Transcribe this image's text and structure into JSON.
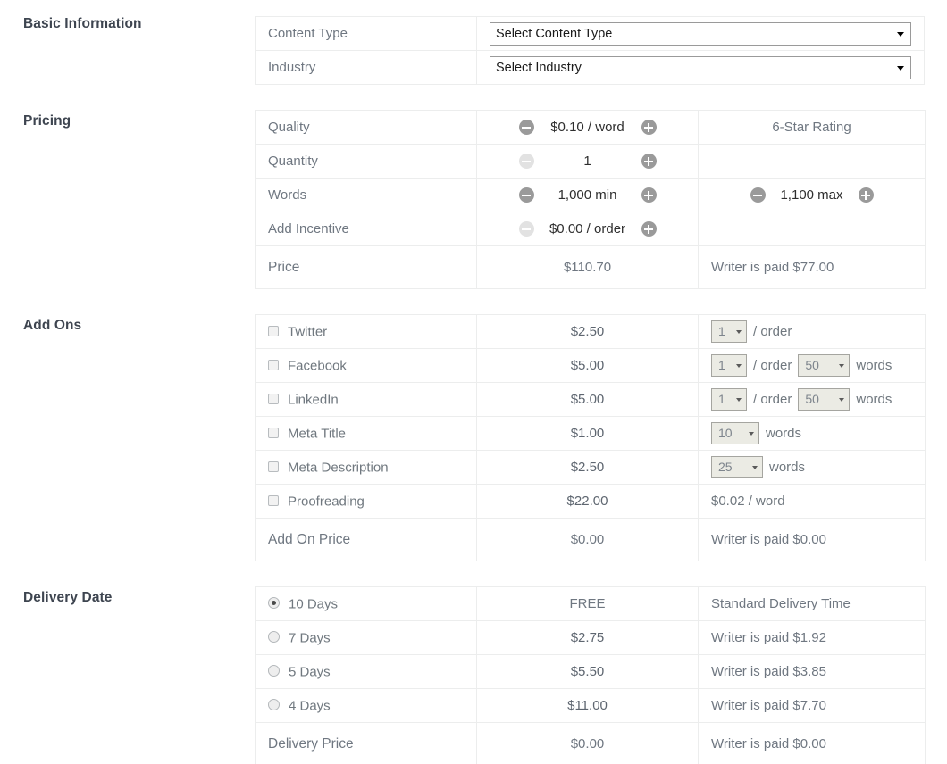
{
  "colors": {
    "accent_green": "#8cc63f",
    "soft_green": "#a9d159",
    "label_dark": "#3e4550",
    "text_gray": "#6f7781",
    "border": "#eceded"
  },
  "sections": {
    "basic": {
      "label": "Basic Information"
    },
    "pricing": {
      "label": "Pricing"
    },
    "addons": {
      "label": "Add Ons"
    },
    "delivery": {
      "label": "Delivery Date"
    }
  },
  "basic_information": {
    "rows": [
      {
        "label": "Content Type",
        "select_value": "Select Content Type"
      },
      {
        "label": "Industry",
        "select_value": "Select Industry"
      }
    ]
  },
  "pricing": {
    "rows": [
      {
        "label": "Quality",
        "minus_enabled": true,
        "plus_enabled": true,
        "value": "$0.10 / word",
        "right_text": "6-Star Rating",
        "right_stepper": false
      },
      {
        "label": "Quantity",
        "minus_enabled": false,
        "plus_enabled": true,
        "value": "1",
        "right_text": "",
        "right_stepper": false
      },
      {
        "label": "Words",
        "minus_enabled": true,
        "plus_enabled": true,
        "value": "1,000 min",
        "right_text": "",
        "right_stepper": true,
        "right_minus_enabled": true,
        "right_plus_enabled": true,
        "right_value": "1,100 max"
      },
      {
        "label": "Add Incentive",
        "minus_enabled": false,
        "plus_enabled": true,
        "value": "$0.00 / order",
        "right_text": "",
        "right_stepper": false
      }
    ],
    "total": {
      "label": "Price",
      "amount": "$110.70",
      "writer_paid": "Writer is paid $77.00"
    }
  },
  "addons": {
    "rows": [
      {
        "label": "Twitter",
        "checked": false,
        "price": "$2.50",
        "controls": [
          {
            "type": "select",
            "value": "1",
            "size": "w1"
          },
          {
            "type": "text",
            "value": "/ order"
          }
        ]
      },
      {
        "label": "Facebook",
        "checked": false,
        "price": "$5.00",
        "controls": [
          {
            "type": "select",
            "value": "1",
            "size": "w1"
          },
          {
            "type": "text",
            "value": "/ order"
          },
          {
            "type": "select",
            "value": "50",
            "size": "w3"
          },
          {
            "type": "text",
            "value": "words"
          }
        ]
      },
      {
        "label": "LinkedIn",
        "checked": false,
        "price": "$5.00",
        "controls": [
          {
            "type": "select",
            "value": "1",
            "size": "w1"
          },
          {
            "type": "text",
            "value": "/ order"
          },
          {
            "type": "select",
            "value": "50",
            "size": "w3"
          },
          {
            "type": "text",
            "value": "words"
          }
        ]
      },
      {
        "label": "Meta Title",
        "checked": false,
        "price": "$1.00",
        "controls": [
          {
            "type": "select",
            "value": "10",
            "size": "w2"
          },
          {
            "type": "text",
            "value": "words"
          }
        ]
      },
      {
        "label": "Meta Description",
        "checked": false,
        "price": "$2.50",
        "controls": [
          {
            "type": "select",
            "value": "25",
            "size": "w3"
          },
          {
            "type": "text",
            "value": "words"
          }
        ]
      },
      {
        "label": "Proofreading",
        "checked": false,
        "price": "$22.00",
        "controls": [
          {
            "type": "text",
            "value": "$0.02 / word"
          }
        ]
      }
    ],
    "total": {
      "label": "Add On Price",
      "amount": "$0.00",
      "writer_paid": "Writer is paid $0.00"
    }
  },
  "delivery": {
    "rows": [
      {
        "label": "10 Days",
        "selected": true,
        "price": "FREE",
        "price_free": true,
        "note": "Standard Delivery Time"
      },
      {
        "label": "7 Days",
        "selected": false,
        "price": "$2.75",
        "price_free": false,
        "note": "Writer is paid $1.92"
      },
      {
        "label": "5 Days",
        "selected": false,
        "price": "$5.50",
        "price_free": false,
        "note": "Writer is paid $3.85"
      },
      {
        "label": "4 Days",
        "selected": false,
        "price": "$11.00",
        "price_free": false,
        "note": "Writer is paid $7.70"
      }
    ],
    "total": {
      "label": "Delivery Price",
      "amount": "$0.00",
      "writer_paid": "Writer is paid $0.00"
    }
  }
}
